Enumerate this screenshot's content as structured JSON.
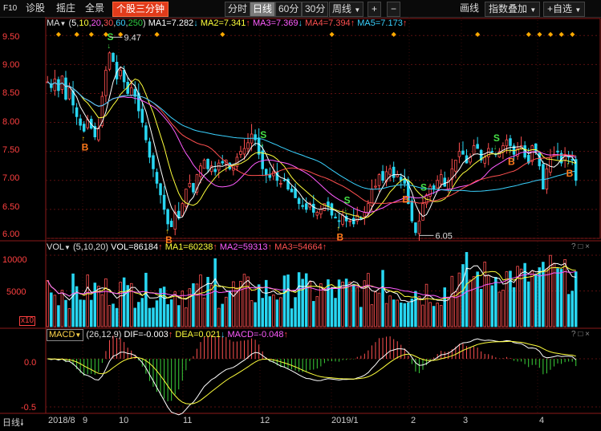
{
  "toolbar": {
    "left": [
      {
        "label": "F10",
        "kind": "plain"
      },
      {
        "label": "诊股",
        "kind": "plain"
      },
      {
        "label": "摇庄",
        "kind": "plain"
      },
      {
        "label": "全景",
        "kind": "plain"
      },
      {
        "label": "个股三分钟",
        "kind": "active"
      }
    ],
    "timeframes": [
      {
        "label": "分时",
        "active": false
      },
      {
        "label": "日线",
        "active": true
      },
      {
        "label": "60分",
        "active": false
      },
      {
        "label": "30分",
        "active": false
      },
      {
        "label": "周线",
        "active": false
      }
    ],
    "timeframe_dropdown_icon": "chevron-down-icon",
    "plus_label": "+",
    "minus_label": "−",
    "right": [
      {
        "label": "画线"
      },
      {
        "label": "指数叠加"
      },
      {
        "label": "+自选"
      }
    ]
  },
  "price_panel": {
    "legend": {
      "name": "MA",
      "params": [
        "5",
        "10",
        "20",
        "30",
        "60",
        "250"
      ],
      "ma1": "MA1=7.282",
      "ma2": "MA2=7.341",
      "ma3": "MA3=7.369",
      "ma4": "MA4=7.394",
      "ma5": "MA5=7.173",
      "arrows": [
        "↓",
        "↑",
        "↓",
        "↑",
        "↑"
      ]
    },
    "y_ticks": [
      "9.50",
      "9.00",
      "8.50",
      "8.00",
      "7.50",
      "7.00",
      "6.50",
      "6.00"
    ],
    "high_label": "9.47",
    "low_label": "6.05",
    "buy_label": "B",
    "sell_label": "S",
    "colors": {
      "up": "#ff5050",
      "down": "#28d7f2",
      "ma1": "#ffffff",
      "ma2": "#ffff3c",
      "ma3": "#ff5cff",
      "ma4": "#ff5050",
      "ma5": "#3ad2ff"
    }
  },
  "volume_panel": {
    "legend": {
      "name": "VOL",
      "params": "(5,10,20)",
      "vol": "VOL=86184",
      "ma1": "MA1=60238",
      "ma2": "MA2=59313",
      "ma3": "MA3=54664",
      "arrows": [
        "↑",
        "↑",
        "↑",
        "↑"
      ]
    },
    "y_ticks": [
      "10000",
      "5000"
    ],
    "unit_label": "x10"
  },
  "macd_panel": {
    "legend": {
      "name": "MACD",
      "params": "(26,12,9)",
      "dif": "DIF=-0.003",
      "dea": "DEA=0.021",
      "macd": "MACD=-0.048",
      "arrows": [
        "↑",
        "↓",
        "↑"
      ]
    },
    "y_ticks": [
      "0.0",
      "-0.5"
    ]
  },
  "xaxis": {
    "period_label": "日线",
    "labels": [
      "2018/8",
      "9",
      "10",
      "11",
      "12",
      "2019/1",
      "2",
      "3",
      "4"
    ]
  },
  "panel_buttons": [
    "?",
    "□",
    "×"
  ],
  "chart_data": {
    "type": "candlestick",
    "title": "",
    "period": "daily",
    "x_range": [
      "2018/8",
      "2019/4"
    ],
    "ylim": [
      6.0,
      9.6
    ],
    "key_prices": {
      "high": 9.47,
      "low": 6.05
    },
    "closes": [
      8.7,
      8.6,
      8.75,
      8.55,
      8.8,
      8.4,
      8.6,
      8.3,
      8.1,
      7.95,
      7.85,
      8.05,
      7.9,
      7.75,
      7.9,
      8.45,
      8.9,
      9.2,
      9.05,
      8.75,
      8.9,
      8.7,
      8.5,
      8.6,
      8.45,
      8.2,
      8.0,
      7.7,
      7.4,
      7.2,
      6.95,
      6.75,
      6.5,
      6.25,
      6.2,
      6.45,
      6.35,
      6.6,
      6.85,
      6.95,
      6.8,
      7.1,
      7.25,
      7.35,
      7.2,
      7.25,
      7.15,
      7.3,
      7.3,
      7.35,
      7.2,
      7.25,
      7.4,
      7.5,
      7.55,
      7.65,
      7.8,
      7.7,
      7.45,
      7.2,
      7.1,
      7.05,
      7.15,
      7.0,
      6.95,
      7.0,
      6.85,
      6.8,
      6.7,
      6.6,
      6.55,
      6.5,
      6.6,
      6.45,
      6.45,
      6.5,
      6.6,
      6.55,
      6.4,
      6.35,
      6.3,
      6.4,
      6.3,
      6.3,
      6.25,
      6.4,
      6.35,
      6.45,
      6.6,
      6.85,
      6.9,
      7.1,
      7.0,
      7.15,
      7.2,
      7.05,
      7.1,
      7.0,
      6.95,
      6.6,
      6.3,
      6.1,
      6.3,
      6.6,
      6.75,
      6.9,
      6.85,
      7.0,
      7.1,
      6.9,
      7.0,
      7.2,
      7.35,
      7.5,
      7.45,
      7.3,
      7.4,
      7.6,
      7.55,
      7.35,
      7.4,
      7.55,
      7.5,
      7.45,
      7.5,
      7.6,
      7.7,
      7.6,
      7.45,
      7.55,
      7.6,
      7.4,
      7.3,
      7.6,
      7.5,
      7.25,
      6.85,
      7.2,
      7.4,
      7.45,
      7.5,
      7.3,
      7.45,
      7.4,
      7.35,
      7.0
    ],
    "ma_current": {
      "MA1": 7.282,
      "MA2": 7.341,
      "MA3": 7.369,
      "MA4": 7.394,
      "MA5": 7.173
    },
    "volume_current": {
      "VOL": 86184,
      "MA1": 60238,
      "MA2": 59313,
      "MA3": 54664
    },
    "macd_current": {
      "DIF": -0.003,
      "DEA": 0.021,
      "MACD": -0.048
    },
    "volume_ylim": [
      0,
      10000
    ],
    "macd_ylim": [
      -0.55,
      0.15
    ]
  }
}
